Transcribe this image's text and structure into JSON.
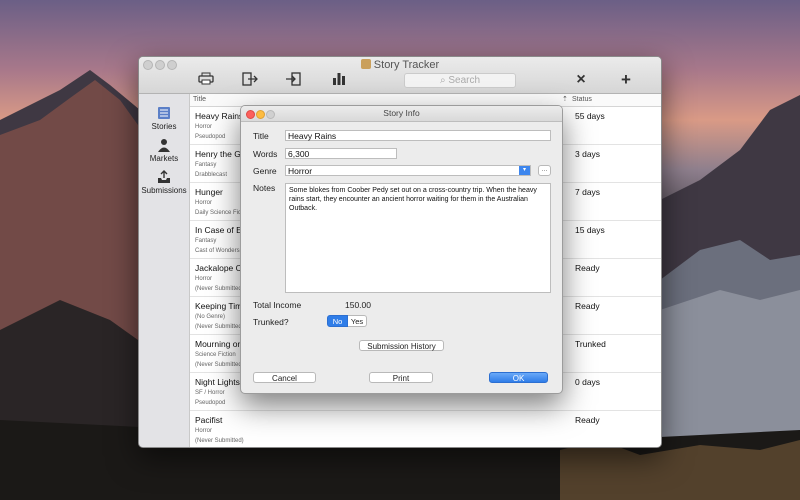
{
  "app": {
    "title": "Story Tracker"
  },
  "toolbar": {
    "print_icon": "printer-icon",
    "export_icon": "export-icon",
    "import_icon": "import-icon",
    "stats_icon": "bar-chart-icon",
    "delete_icon": "×",
    "add_icon": "+",
    "search_placeholder": "Search"
  },
  "sidebar": {
    "items": [
      {
        "label": "Stories",
        "icon": "stories-icon"
      },
      {
        "label": "Markets",
        "icon": "person-icon"
      },
      {
        "label": "Submissions",
        "icon": "outbox-icon"
      }
    ]
  },
  "list": {
    "columns": {
      "title": "Title",
      "status": "Status"
    },
    "rows": [
      {
        "title": "Heavy Rains",
        "genre": "Horror",
        "market": "Pseudopod",
        "status": "55 days"
      },
      {
        "title": "Henry the Gre",
        "genre": "Fantasy",
        "market": "Drabblecast",
        "status": "3 days"
      },
      {
        "title": "Hunger",
        "genre": "Horror",
        "market": "Daily Science Fictio",
        "status": "7 days"
      },
      {
        "title": "In Case of Em",
        "genre": "Fantasy",
        "market": "Cast of Wonders",
        "status": "15 days"
      },
      {
        "title": "Jackalope Co",
        "genre": "Horror",
        "market": "(Never Submitted)",
        "status": "Ready"
      },
      {
        "title": "Keeping Time",
        "genre": "(No Genre)",
        "market": "(Never Submitted)",
        "status": "Ready"
      },
      {
        "title": "Mourning on",
        "genre": "Science Fiction",
        "market": "(Never Submitted)",
        "status": "Trunked"
      },
      {
        "title": "Night Lights",
        "genre": "SF / Horror",
        "market": "Pseudopod",
        "status": "0 days"
      },
      {
        "title": "Pacifist",
        "genre": "Horror",
        "market": "(Never Submitted)",
        "status": "Ready"
      }
    ]
  },
  "dialog": {
    "title": "Story Info",
    "labels": {
      "title": "Title",
      "words": "Words",
      "genre": "Genre",
      "notes": "Notes",
      "income": "Total Income",
      "trunked": "Trunked?"
    },
    "values": {
      "title": "Heavy Rains",
      "words": "6,300",
      "genre": "Horror",
      "notes": "Some blokes from Coober Pedy set out on a cross-country trip. When the heavy rains start, they encounter an ancient horror waiting for them in the Australian Outback.",
      "income": "150.00"
    },
    "trunked": {
      "no": "No",
      "yes": "Yes"
    },
    "more_label": "···",
    "buttons": {
      "history": "Submission History",
      "cancel": "Cancel",
      "print": "Print",
      "ok": "OK"
    }
  }
}
